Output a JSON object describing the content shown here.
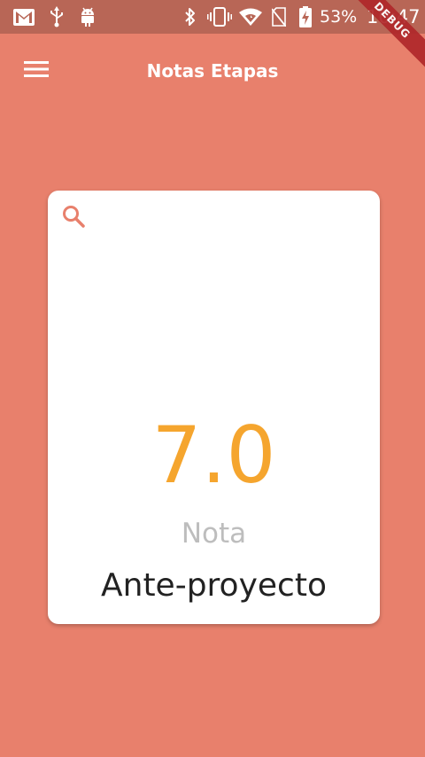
{
  "status_bar": {
    "battery_percent": "53%",
    "time": "10:47",
    "icons_left": [
      "gmail-icon",
      "usb-icon",
      "android-debug-icon"
    ],
    "icons_right": [
      "bluetooth-icon",
      "vibrate-icon",
      "wifi-icon",
      "no-sim-icon",
      "battery-charging-icon"
    ]
  },
  "debug_banner": {
    "label": "DEBUG"
  },
  "app_bar": {
    "title": "Notas Etapas",
    "menu_icon": "menu-icon"
  },
  "card": {
    "search_icon": "search-icon",
    "grade": "7.0",
    "grade_label": "Nota",
    "stage": "Ante-proyecto"
  },
  "colors": {
    "background": "#E8806C",
    "status_bar": "#B86656",
    "grade": "#F5A52E",
    "search_icon": "#E8806C",
    "debug_ribbon": "#B0282A"
  }
}
